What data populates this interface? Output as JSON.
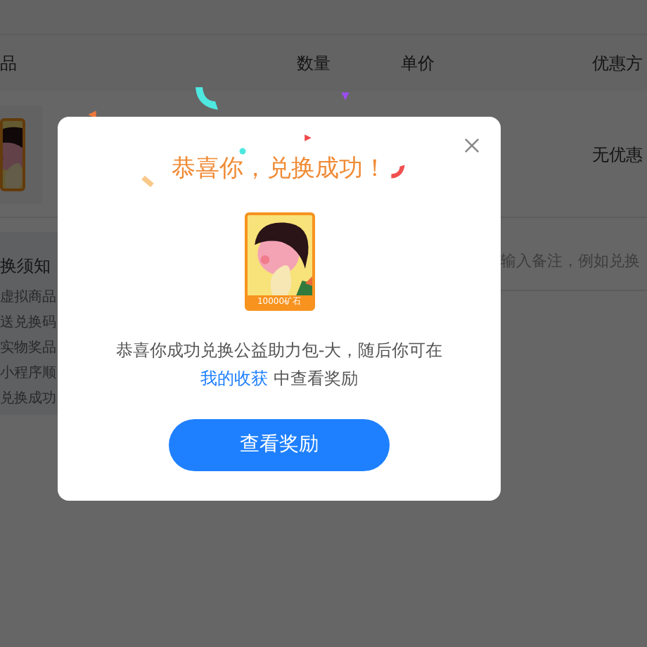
{
  "page": {
    "table": {
      "columns": [
        "品",
        "数量",
        "单价",
        "优惠方"
      ],
      "row": {
        "discount": "无优惠"
      }
    },
    "notice": {
      "title": "换须知",
      "lines": [
        "虚拟商品",
        "送兑换码",
        "实物奖品",
        "小程序顺",
        "兑换成功"
      ]
    },
    "remark": {
      "placeholder": "输入备注，例如兑换"
    }
  },
  "dialog": {
    "title": "恭喜你，兑换成功！",
    "card_label": "10000矿石",
    "message_before": "恭喜你成功兑换公益助力包-大，随后你可在 ",
    "link": "我的收获",
    "message_after": " 中查看奖励",
    "button": "查看奖励"
  }
}
